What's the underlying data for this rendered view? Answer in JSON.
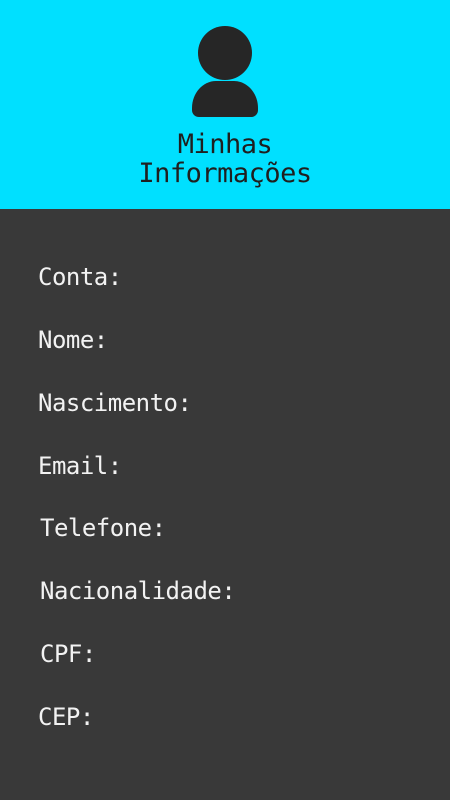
{
  "colors": {
    "header_bg": "#00e0ff",
    "content_bg": "#393939",
    "title_text": "#1f1f1f",
    "field_text": "#f2f2f2"
  },
  "header": {
    "icon": "user-icon",
    "title_line1": "Minhas",
    "title_line2": "Informações"
  },
  "fields": [
    {
      "label": "Conta:"
    },
    {
      "label": "Nome:"
    },
    {
      "label": "Nascimento:"
    },
    {
      "label": "Email:"
    },
    {
      "label": "Telefone:"
    },
    {
      "label": "Nacionalidade:"
    },
    {
      "label": "CPF:"
    },
    {
      "label": "CEP:"
    }
  ]
}
